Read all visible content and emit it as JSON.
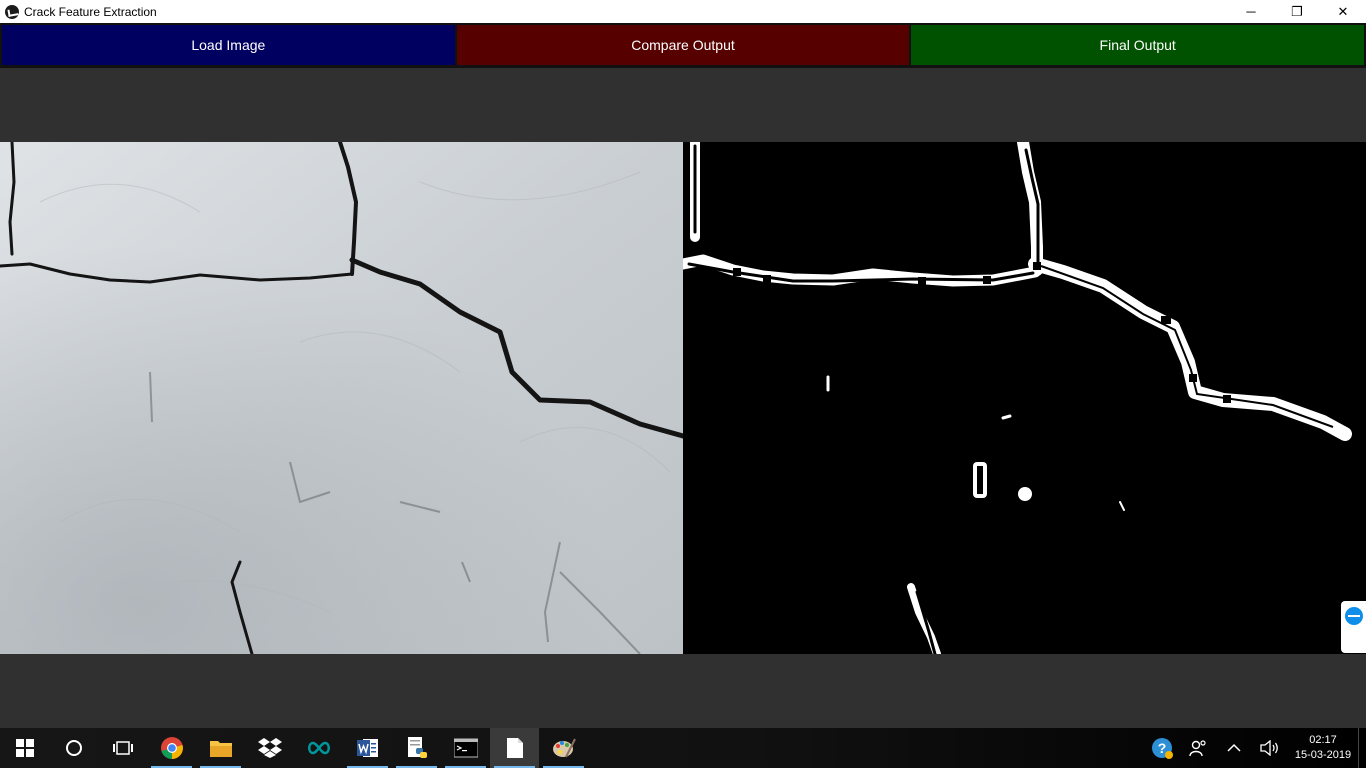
{
  "window": {
    "title": "Crack Feature Extraction",
    "minimize_glyph": "─",
    "restore_glyph": "❐",
    "close_glyph": "✕"
  },
  "toolbar": {
    "load_label": "Load Image",
    "compare_label": "Compare Output",
    "final_label": "Final Output",
    "colors": {
      "load": "#000060",
      "compare": "#560000",
      "final": "#005200"
    }
  },
  "images": {
    "left": "original-crack-photo",
    "right": "binary-crack-output"
  },
  "taskbar": {
    "items": [
      {
        "name": "start-button",
        "icon": "windows-icon"
      },
      {
        "name": "search-button",
        "icon": "cortana-circle-icon"
      },
      {
        "name": "task-view-button",
        "icon": "task-view-icon"
      },
      {
        "name": "chrome",
        "icon": "chrome-icon"
      },
      {
        "name": "file-explorer",
        "icon": "folder-icon"
      },
      {
        "name": "dropbox",
        "icon": "dropbox-icon"
      },
      {
        "name": "arduino",
        "icon": "infinity-icon"
      },
      {
        "name": "word",
        "icon": "word-icon"
      },
      {
        "name": "python",
        "icon": "python-icon"
      },
      {
        "name": "command-prompt",
        "icon": "terminal-icon"
      },
      {
        "name": "document",
        "icon": "document-icon"
      },
      {
        "name": "paint",
        "icon": "paint-icon"
      }
    ],
    "time": "02:17",
    "date": "15-03-2019"
  }
}
